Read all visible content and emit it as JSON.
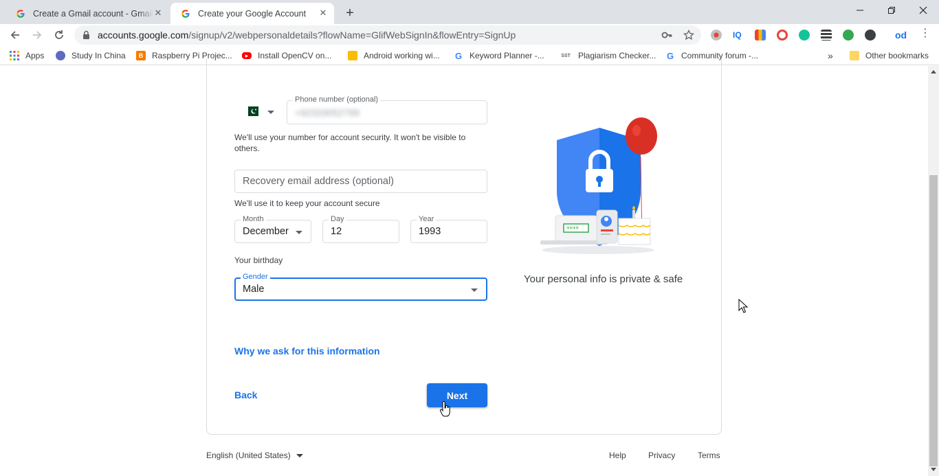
{
  "colors": {
    "accent": "#1a73e8",
    "tabstrip": "#dee1e6",
    "border": "#dadce0"
  },
  "tabs": [
    {
      "title": "Create a Gmail account - Gmail H",
      "icon": "google-g-icon"
    },
    {
      "title": "Create your Google Account",
      "icon": "google-g-icon"
    }
  ],
  "omnibox": {
    "host": "accounts.google.com",
    "path": "/signup/v2/webpersonaldetails?flowName=GlifWebSignIn&flowEntry=SignUp"
  },
  "bookmarks": {
    "apps": "Apps",
    "items": [
      "Study In China",
      "Raspberry Pi Projec...",
      "Install OpenCV on...",
      "Android working wi...",
      "Keyword Planner -...",
      "Plagiarism Checker...",
      "Community forum -..."
    ],
    "other": "Other bookmarks"
  },
  "form": {
    "phone": {
      "label": "Phone number (optional)",
      "value": "+92333052799"
    },
    "phone_helper": "We'll use your number for account security. It won't be visible to others.",
    "recovery": {
      "placeholder": "Recovery email address (optional)"
    },
    "recovery_helper": "We'll use it to keep your account secure",
    "month": {
      "label": "Month",
      "value": "December"
    },
    "day": {
      "label": "Day",
      "value": "12"
    },
    "year": {
      "label": "Year",
      "value": "1993"
    },
    "birthday_helper": "Your birthday",
    "gender": {
      "label": "Gender",
      "value": "Male"
    },
    "why_link": "Why we ask for this information",
    "back": "Back",
    "next": "Next"
  },
  "illustration_caption": "Your personal info is private & safe",
  "footer": {
    "language": "English (United States)",
    "links": [
      "Help",
      "Privacy",
      "Terms"
    ]
  }
}
